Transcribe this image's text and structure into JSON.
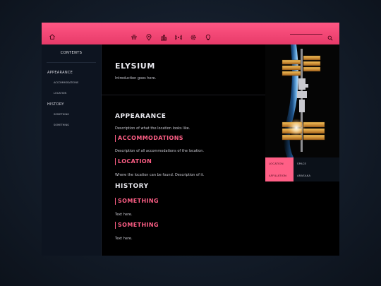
{
  "nav": {
    "icons": [
      "home-icon",
      "tree-icon",
      "map-pin-icon",
      "city-icon",
      "broadcast-icon",
      "gear-icon",
      "lightbulb-icon",
      "search-icon"
    ],
    "search_placeholder": ""
  },
  "sidebar": {
    "title": "CONTENTS",
    "items": [
      {
        "label": "APPEARANCE",
        "level": 1
      },
      {
        "label": "ACCOMMODATIONS",
        "level": 2
      },
      {
        "label": "LOCATION",
        "level": 2
      },
      {
        "label": "HISTORY",
        "level": 1
      },
      {
        "label": "SOMETHING",
        "level": 2
      },
      {
        "label": "SOMETHING",
        "level": 2
      }
    ]
  },
  "article": {
    "title": "ELYSIUM",
    "intro": "Introduction goes here.",
    "appearance": {
      "heading": "APPEARANCE",
      "text": "Description of what the location looks like."
    },
    "accommodations": {
      "heading": "ACCOMMODATIONS",
      "text": "Description of all accommodations of the location."
    },
    "location": {
      "heading": "LOCATION",
      "text": "Where the location can be found. Description of it."
    },
    "history": {
      "heading": "HISTORY",
      "sections": [
        {
          "heading": "SOMETHING",
          "text": "Text here."
        },
        {
          "heading": "SOMETHING",
          "text": "Text here."
        }
      ]
    }
  },
  "infobox": {
    "image_subject": "space-station-image",
    "rows": [
      {
        "label": "LOCATION",
        "value": "SPACE"
      },
      {
        "label": "AFFILIATION",
        "value": "ARASAKA"
      }
    ]
  },
  "colors": {
    "accent": "#ff5f86",
    "topbar": "#ef4572",
    "sidebar_bg": "#0d1420",
    "page_bg": "#131c29"
  }
}
